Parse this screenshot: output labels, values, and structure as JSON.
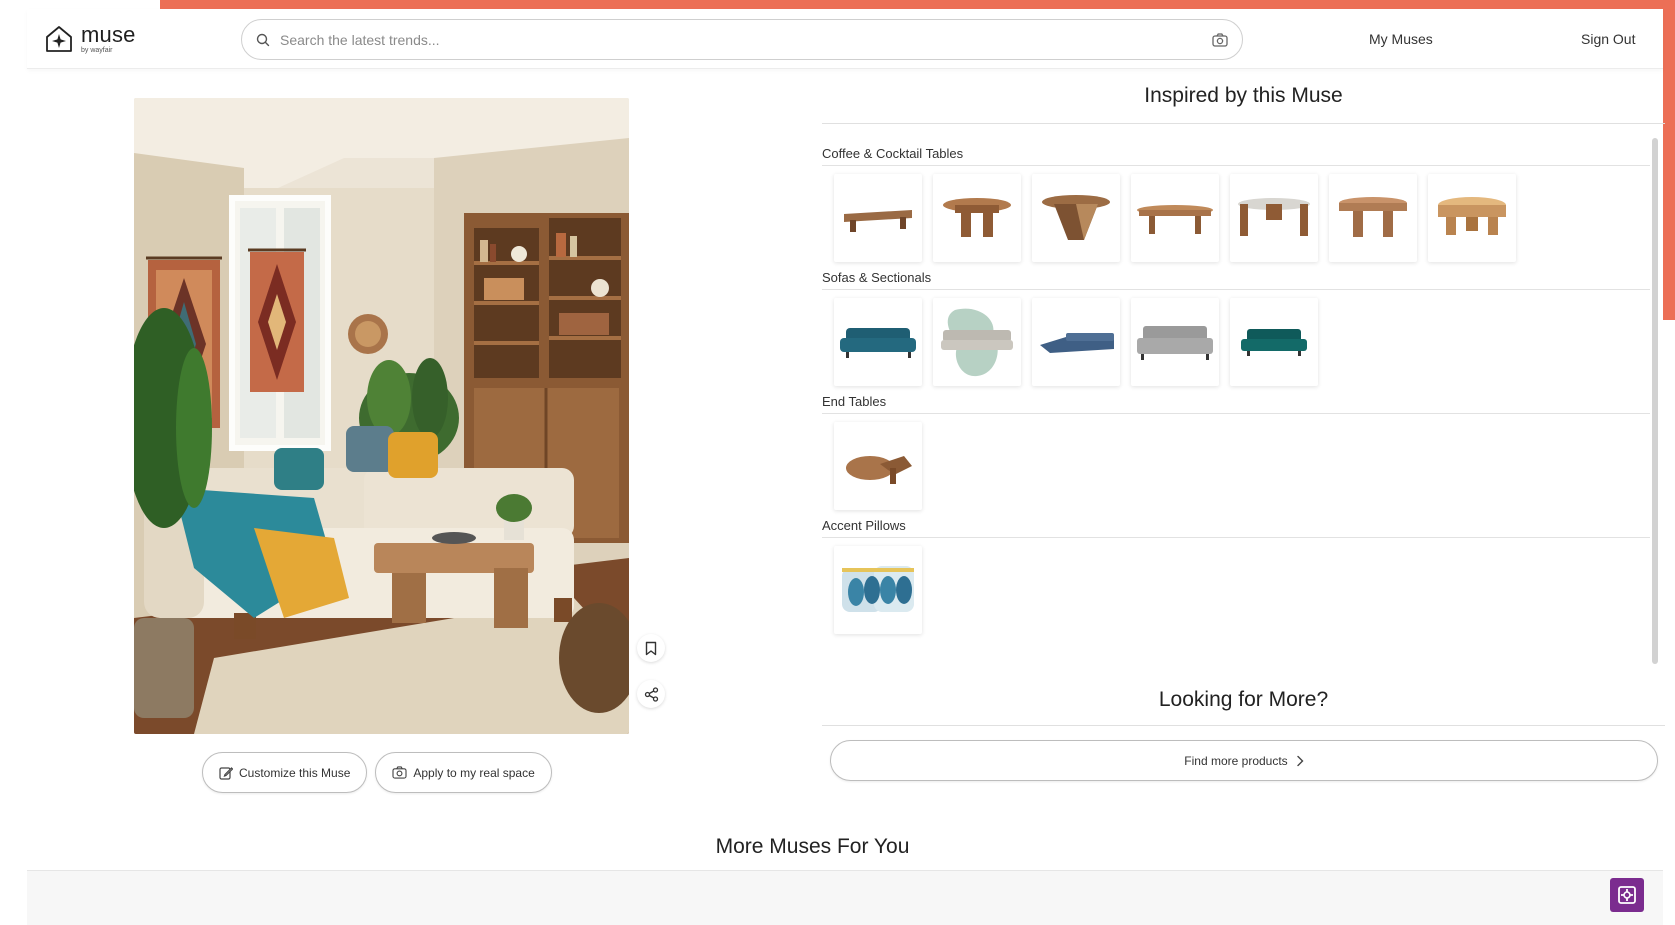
{
  "header": {
    "logo_word": "muse",
    "logo_sub": "by wayfair",
    "search_placeholder": "Search the latest trends...",
    "my_muses": "My Muses",
    "sign_out": "Sign Out"
  },
  "hero": {
    "customize_label": "Customize this Muse",
    "apply_label": "Apply to my real space"
  },
  "panel": {
    "title": "Inspired by this Muse",
    "categories": [
      {
        "label": "Coffee & Cocktail Tables",
        "count": 7
      },
      {
        "label": "Sofas & Sectionals",
        "count": 5
      },
      {
        "label": "End Tables",
        "count": 1
      },
      {
        "label": "Accent Pillows",
        "count": 1
      }
    ],
    "looking_title": "Looking for More?",
    "find_more_label": "Find more products"
  },
  "more_muses_title": "More Muses For You",
  "colors": {
    "accent": "#ec6f56",
    "corner_button": "#7b2c8f",
    "wood": "#a9744a",
    "sofa_teal": "#1f5e73"
  },
  "icons": [
    "search-icon",
    "camera-icon",
    "bookmark-icon",
    "share-icon",
    "edit-icon",
    "chevron-right-icon",
    "expand-icon"
  ]
}
